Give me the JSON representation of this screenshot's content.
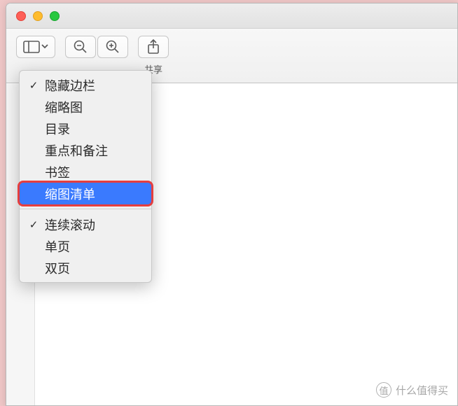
{
  "toolbar": {
    "share_label": "共享"
  },
  "menu": {
    "group1": [
      {
        "label": "隐藏边栏",
        "checked": true,
        "selected": false
      },
      {
        "label": "缩略图",
        "checked": false,
        "selected": false
      },
      {
        "label": "目录",
        "checked": false,
        "selected": false
      },
      {
        "label": "重点和备注",
        "checked": false,
        "selected": false
      },
      {
        "label": "书签",
        "checked": false,
        "selected": false
      },
      {
        "label": "缩图清单",
        "checked": false,
        "selected": true
      }
    ],
    "group2": [
      {
        "label": "连续滚动",
        "checked": true,
        "selected": false
      },
      {
        "label": "单页",
        "checked": false,
        "selected": false
      },
      {
        "label": "双页",
        "checked": false,
        "selected": false
      }
    ]
  },
  "watermark": {
    "icon": "值",
    "text": "什么值得买"
  }
}
